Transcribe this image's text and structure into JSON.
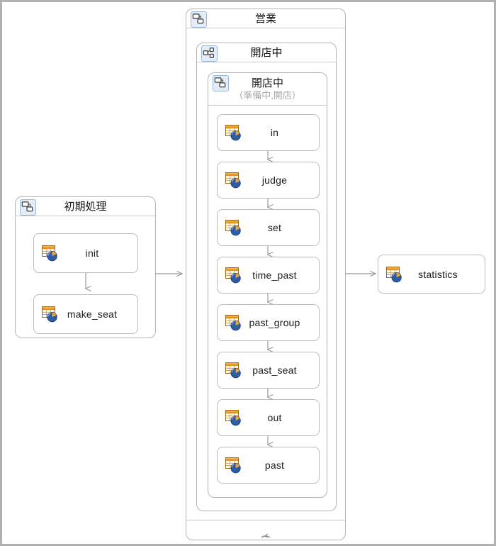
{
  "diagram": {
    "title": "",
    "colors": {
      "canvas_border": "#b0b0b0",
      "panel_border": "#b5b5b5",
      "node_border": "#bcbcbc",
      "connector": "#9a9a9a",
      "subtitle_text": "#a8a8a8",
      "icon_table_header": "#e08a20",
      "icon_pie_blue": "#2f5fa8",
      "icon_pie_orange": "#f0a32a",
      "panel_icon_bg": "#e4edf7"
    }
  },
  "panels": {
    "init": {
      "name": "初期処理",
      "icon": "composite-structure-icon",
      "nodes": [
        {
          "label": "init",
          "icon": "table-chart-icon"
        },
        {
          "label": "make_seat",
          "icon": "table-chart-icon"
        }
      ]
    },
    "business": {
      "name": "営業",
      "icon": "composite-structure-icon",
      "inner": {
        "name": "開店中",
        "icon": "collaboration-icon",
        "inner": {
          "name": "開店中",
          "subtitle": "（準備中,開店）",
          "icon": "composite-structure-icon",
          "nodes": [
            {
              "label": "in",
              "icon": "table-chart-icon"
            },
            {
              "label": "judge",
              "icon": "table-chart-icon"
            },
            {
              "label": "set",
              "icon": "table-chart-icon"
            },
            {
              "label": "time_past",
              "icon": "table-chart-icon"
            },
            {
              "label": "past_group",
              "icon": "table-chart-icon"
            },
            {
              "label": "past_seat",
              "icon": "table-chart-icon"
            },
            {
              "label": "out",
              "icon": "table-chart-icon"
            },
            {
              "label": "past",
              "icon": "table-chart-icon"
            }
          ]
        }
      },
      "footer_icon": "loop-arrow-icon"
    },
    "statistics": {
      "nodes": [
        {
          "label": "statistics",
          "icon": "table-chart-icon"
        }
      ]
    }
  },
  "connectors": [
    {
      "from": "init-panel",
      "to": "business-panel",
      "kind": "arrow-right"
    },
    {
      "from": "business-panel",
      "to": "statistics-node",
      "kind": "arrow-right"
    }
  ]
}
